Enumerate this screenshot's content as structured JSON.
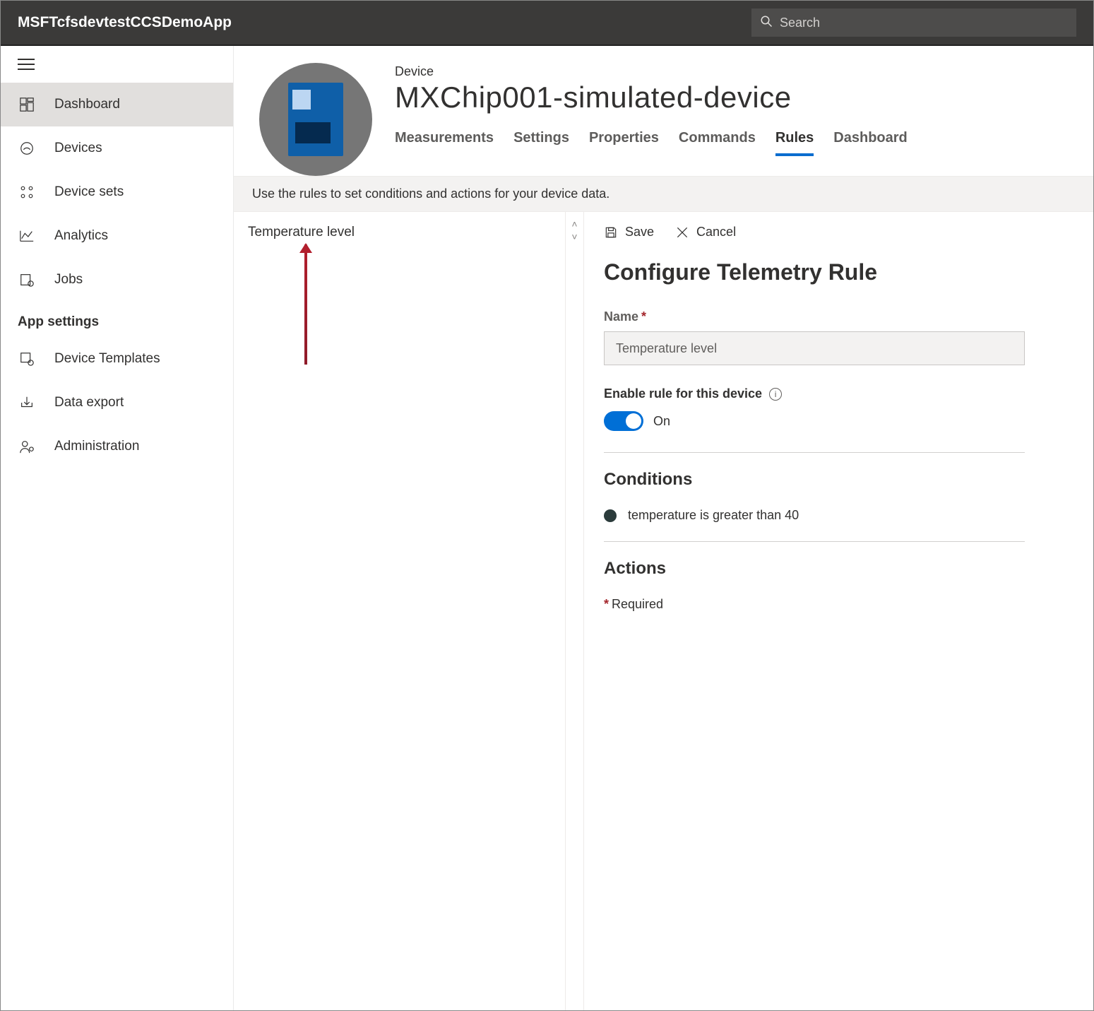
{
  "app_title": "MSFTcfsdevtestCCSDemoApp",
  "search": {
    "placeholder": "Search"
  },
  "sidebar": {
    "items": [
      {
        "label": "Dashboard",
        "icon": "dashboard-icon",
        "active": true
      },
      {
        "label": "Devices",
        "icon": "devices-icon"
      },
      {
        "label": "Device sets",
        "icon": "devicesets-icon"
      },
      {
        "label": "Analytics",
        "icon": "analytics-icon"
      },
      {
        "label": "Jobs",
        "icon": "jobs-icon"
      }
    ],
    "section_title": "App settings",
    "settings_items": [
      {
        "label": "Device Templates",
        "icon": "templates-icon"
      },
      {
        "label": "Data export",
        "icon": "export-icon"
      },
      {
        "label": "Administration",
        "icon": "admin-icon"
      }
    ]
  },
  "device": {
    "eyebrow": "Device",
    "name": "MXChip001-simulated-device",
    "tabs": [
      {
        "label": "Measurements"
      },
      {
        "label": "Settings"
      },
      {
        "label": "Properties"
      },
      {
        "label": "Commands"
      },
      {
        "label": "Rules",
        "active": true
      },
      {
        "label": "Dashboard"
      }
    ]
  },
  "banner": "Use the rules to set conditions and actions for your device data.",
  "rules_list": {
    "items": [
      {
        "label": "Temperature level"
      }
    ]
  },
  "rule_pane": {
    "toolbar": {
      "save": "Save",
      "cancel": "Cancel"
    },
    "title": "Configure Telemetry Rule",
    "name_label": "Name",
    "name_value": "Temperature level",
    "enable_label": "Enable rule for this device",
    "toggle_state": "On",
    "conditions_title": "Conditions",
    "condition_text": "temperature is greater than 40",
    "actions_title": "Actions",
    "required_note": "Required"
  }
}
